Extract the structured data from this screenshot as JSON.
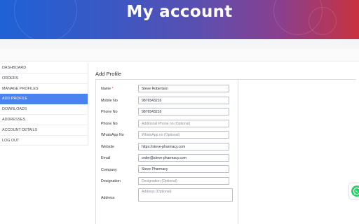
{
  "header": {
    "title": "My account"
  },
  "sidebar": {
    "items": [
      {
        "label": "DASHBOARD",
        "active": false
      },
      {
        "label": "ORDERS",
        "active": false
      },
      {
        "label": "MANAGE PROFILES",
        "active": false
      },
      {
        "label": "ADD PROFILE",
        "active": true
      },
      {
        "label": "DOWNLOADS",
        "active": false
      },
      {
        "label": "ADDRESSES",
        "active": false
      },
      {
        "label": "ACCOUNT DETAILS",
        "active": false
      },
      {
        "label": "LOG OUT",
        "active": false
      }
    ]
  },
  "form": {
    "title": "Add Profile",
    "required_mark": "*",
    "name": {
      "label": "Name",
      "value": "Steve Robertson",
      "placeholder": ""
    },
    "mobile": {
      "label": "Mobile No",
      "value": "9876543216",
      "placeholder": ""
    },
    "phone": {
      "label": "Phone No",
      "value": "9876543216",
      "placeholder": ""
    },
    "phone_alt": {
      "label": "Phone No",
      "value": "",
      "placeholder": "Additional Phone no (Optional)"
    },
    "whatsapp": {
      "label": "WhatsApp No",
      "value": "",
      "placeholder": "WhatsApp no (Optional)"
    },
    "website": {
      "label": "Website",
      "value": "https://steve-pharmacy.com",
      "placeholder": ""
    },
    "email": {
      "label": "Email",
      "value": "order@steve-pharmacy.com",
      "placeholder": ""
    },
    "company": {
      "label": "Company",
      "value": "Steve Pharmacy",
      "placeholder": ""
    },
    "designation": {
      "label": "Designation",
      "value": "",
      "placeholder": "Designation (Optional)"
    },
    "address": {
      "label": "Address",
      "value": "",
      "placeholder": "Address (Optional)"
    }
  },
  "colors": {
    "active_nav": "#4a82f0",
    "whatsapp": "#25d366",
    "required": "#d93a3a"
  },
  "icons": {
    "whatsapp": "whatsapp-icon"
  }
}
